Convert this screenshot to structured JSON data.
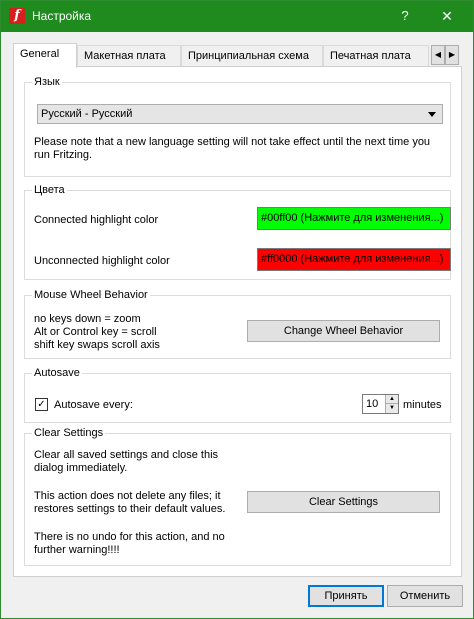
{
  "window": {
    "title": "Настройка",
    "help": "?",
    "close": "✕"
  },
  "tabs": [
    {
      "label": "General"
    },
    {
      "label": "Макетная плата"
    },
    {
      "label": "Принципиальная схема"
    },
    {
      "label": "Печатная плата"
    }
  ],
  "language": {
    "title": "Язык",
    "selected": "Русский - Русский",
    "note_line1": "Please note that a new language setting will not take effect until the next time you",
    "note_line2": "run Fritzing."
  },
  "colors": {
    "title": "Цвета",
    "connected_label": "Connected highlight color",
    "connected_value": "#00ff00 (Нажмите для изменения...)",
    "connected_color": "#00ff00",
    "unconnected_label": "Unconnected highlight color",
    "unconnected_value": "#ff0000 (Нажмите для изменения...)",
    "unconnected_color": "#ff0000"
  },
  "mouse": {
    "title": "Mouse Wheel Behavior",
    "line1": "no keys down = zoom",
    "line2": "Alt or Control key = scroll",
    "line3": "shift key swaps scroll axis",
    "button": "Change Wheel Behavior"
  },
  "autosave": {
    "title": "Autosave",
    "checkbox_label": "Autosave every:",
    "checked": true,
    "value": "10",
    "unit": "minutes"
  },
  "clear": {
    "title": "Clear Settings",
    "p1_l1": "Clear all saved settings and close this",
    "p1_l2": "dialog immediately.",
    "p2_l1": "This action does not delete any files; it",
    "p2_l2": "restores settings to their default values.",
    "p3_l1": "There is no undo for this action, and no",
    "p3_l2": "further warning!!!!",
    "button": "Clear Settings"
  },
  "footer": {
    "ok": "Принять",
    "cancel": "Отменить"
  }
}
